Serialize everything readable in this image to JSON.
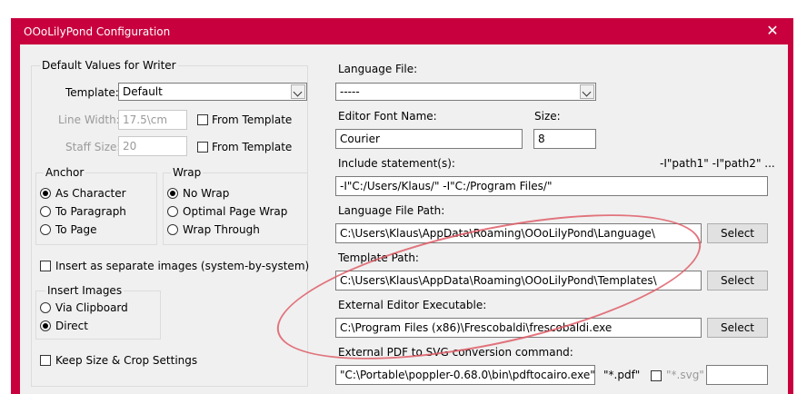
{
  "window": {
    "title": "OOoLilyPond Configuration",
    "close_glyph": "✕",
    "accent": "#c8003e"
  },
  "left": {
    "defaults_group": "Default Values for Writer",
    "template_label": "Template:",
    "template_value": "Default",
    "line_width_label": "Line Width:",
    "line_width_value": "17.5\\cm",
    "from_template_1": "From Template",
    "staff_size_label": "Staff Size:",
    "staff_size_value": "20",
    "from_template_2": "From Template",
    "anchor_group": "Anchor",
    "anchor_options": [
      "As Character",
      "To Paragraph",
      "To Page"
    ],
    "wrap_group": "Wrap",
    "wrap_options": [
      "No Wrap",
      "Optimal Page Wrap",
      "Wrap Through"
    ],
    "insert_separate": "Insert as separate images (system-by-system)",
    "insert_group": "Insert Images",
    "insert_options": [
      "Via Clipboard",
      "Direct"
    ],
    "keep_size": "Keep Size & Crop Settings"
  },
  "right": {
    "language_file_label": "Language File:",
    "language_file_value": "-----",
    "editor_font_label": "Editor Font Name:",
    "editor_font_value": "Courier",
    "size_label": "Size:",
    "size_value": "8",
    "include_label": "Include statement(s):",
    "include_hint": "-I\"path1\" -I\"path2\" ...",
    "include_value": "-I\"C:/Users/Klaus/\" -I\"C:/Program Files/\"",
    "language_path_label": "Language File Path:",
    "language_path_value": "C:\\Users\\Klaus\\AppData\\Roaming\\OOoLilyPond\\Language\\",
    "template_path_label": "Template Path:",
    "template_path_value": "C:\\Users\\Klaus\\AppData\\Roaming\\OOoLilyPond\\Templates\\",
    "editor_exe_label": "External Editor Executable:",
    "editor_exe_value": "C:\\Program Files (x86)\\Frescobaldi\\frescobaldi.exe",
    "pdf_svg_label": "External PDF to SVG conversion command:",
    "pdf_svg_value": "\"C:\\Portable\\poppler-0.68.0\\bin\\pdftocairo.exe\"",
    "pdf_ext": "\"*.pdf\"",
    "svg_ext": "\"*.svg\"",
    "select_label": "Select"
  }
}
